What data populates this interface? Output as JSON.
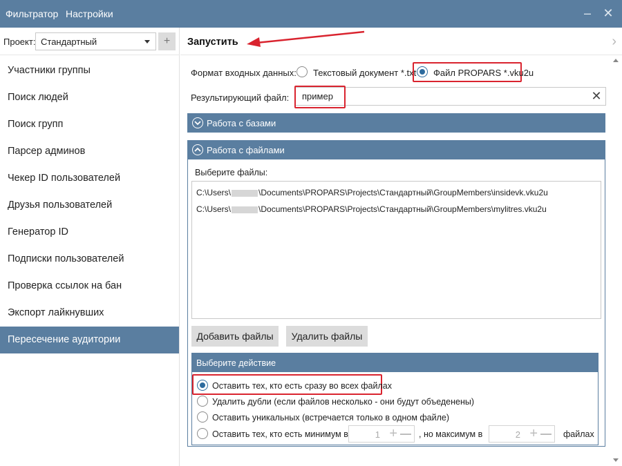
{
  "menu": {
    "filtrator": "Фильтратор",
    "settings": "Настройки"
  },
  "window": {
    "minimize_glyph": "–",
    "close_glyph": "✕"
  },
  "project": {
    "label": "Проект:",
    "selected": "Стандартный",
    "add_glyph": "+"
  },
  "sidebar": {
    "items": [
      {
        "label": "Участники группы",
        "active": false
      },
      {
        "label": "Поиск людей",
        "active": false
      },
      {
        "label": "Поиск групп",
        "active": false
      },
      {
        "label": "Парсер админов",
        "active": false
      },
      {
        "label": "Чекер ID пользователей",
        "active": false
      },
      {
        "label": "Друзья пользователей",
        "active": false
      },
      {
        "label": "Генератор ID",
        "active": false
      },
      {
        "label": "Подписки пользователей",
        "active": false
      },
      {
        "label": "Проверка ссылок на бан",
        "active": false
      },
      {
        "label": "Экспорт лайкнувших",
        "active": false
      },
      {
        "label": "Пересечение аудитории",
        "active": true
      }
    ]
  },
  "header": {
    "run_label": "Запустить",
    "next_glyph": "›"
  },
  "input_format": {
    "label": "Формат входных данных:",
    "option_txt": "Текстовый документ *.txt",
    "option_vku": "Файл PROPARS *.vku2u",
    "selected": "vku"
  },
  "result_file": {
    "label": "Результирующий файл:",
    "value": "пример",
    "clear_glyph": "✕"
  },
  "sections": {
    "bases": "Работа с базами",
    "files": "Работа с файлами"
  },
  "files": {
    "choose_label": "Выберите файлы:",
    "rows": [
      {
        "prefix": "C:\\Users\\",
        "suffix": "\\Documents\\PROPARS\\Projects\\Стандартный\\GroupMembers\\insidevk.vku2u"
      },
      {
        "prefix": "C:\\Users\\",
        "suffix": "\\Documents\\PROPARS\\Projects\\Стандартный\\GroupMembers\\mylitres.vku2u"
      }
    ],
    "add_button": "Добавить файлы",
    "remove_button": "Удалить файлы"
  },
  "action": {
    "header": "Выберите действие",
    "opt1": "Оставить тех, кто есть сразу во всех файлах",
    "opt2": "Удалить дубли (если файлов несколько - они будут объеденены)",
    "opt3": "Оставить уникальных (встречается только в одном файле)",
    "opt4_prefix": "Оставить тех, кто есть  минимум в",
    "opt4_mid": ", но максимум в",
    "opt4_suffix": "файлах",
    "min_value": "1",
    "max_value": "2",
    "selected": 1
  },
  "colors": {
    "accent": "#5a7ea0",
    "highlight": "#d9232e",
    "radio": "#2d6b9e"
  }
}
